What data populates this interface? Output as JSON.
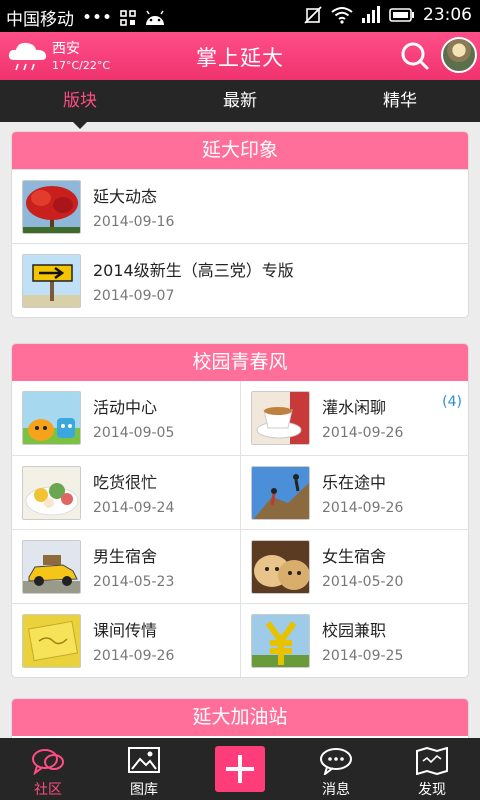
{
  "status_bar": {
    "carrier": "中国移动",
    "dots": "•••",
    "time": "23:06"
  },
  "header": {
    "city": "西安",
    "temperature": "17°C/22°C",
    "title": "掌上延大"
  },
  "tabs": [
    {
      "label": "版块",
      "active": true
    },
    {
      "label": "最新",
      "active": false
    },
    {
      "label": "精华",
      "active": false
    }
  ],
  "sections": {
    "impression": {
      "title": "延大印象",
      "items": [
        {
          "name": "延大动态",
          "date": "2014-09-16",
          "thumb": "red-flower-tree"
        },
        {
          "name": "2014级新生（高三党）专版",
          "date": "2014-09-07",
          "thumb": "yellow-arrow-sign"
        }
      ]
    },
    "youth": {
      "title": "校园青春风",
      "items": [
        {
          "name": "活动中心",
          "date": "2014-09-05",
          "thumb": "cartoon-characters"
        },
        {
          "name": "灌水闲聊",
          "date": "2014-09-26",
          "badge": "(4)",
          "thumb": "tea-cup"
        },
        {
          "name": "吃货很忙",
          "date": "2014-09-24",
          "thumb": "food-plate"
        },
        {
          "name": "乐在途中",
          "date": "2014-09-26",
          "thumb": "rock-climbing"
        },
        {
          "name": "男生宿舍",
          "date": "2014-05-23",
          "thumb": "yellow-car"
        },
        {
          "name": "女生宿舍",
          "date": "2014-05-20",
          "thumb": "puppies"
        },
        {
          "name": "课间传情",
          "date": "2014-09-26",
          "thumb": "yellow-card"
        },
        {
          "name": "校园兼职",
          "date": "2014-09-25",
          "thumb": "yuan-sign"
        }
      ]
    },
    "station": {
      "title": "延大加油站"
    }
  },
  "bottom_nav": [
    {
      "label": "社区",
      "icon": "chat-bubbles-icon",
      "active": true
    },
    {
      "label": "图库",
      "icon": "image-icon",
      "active": false
    },
    {
      "label": "",
      "icon": "plus-icon",
      "active": false
    },
    {
      "label": "消息",
      "icon": "message-icon",
      "active": false
    },
    {
      "label": "发现",
      "icon": "map-icon",
      "active": false
    }
  ],
  "colors": {
    "accent": "#ff4d84",
    "header": "#f0336f",
    "section_head": "#ff6f9a",
    "dark_bar": "#262626",
    "badge": "#2a8fd6"
  }
}
